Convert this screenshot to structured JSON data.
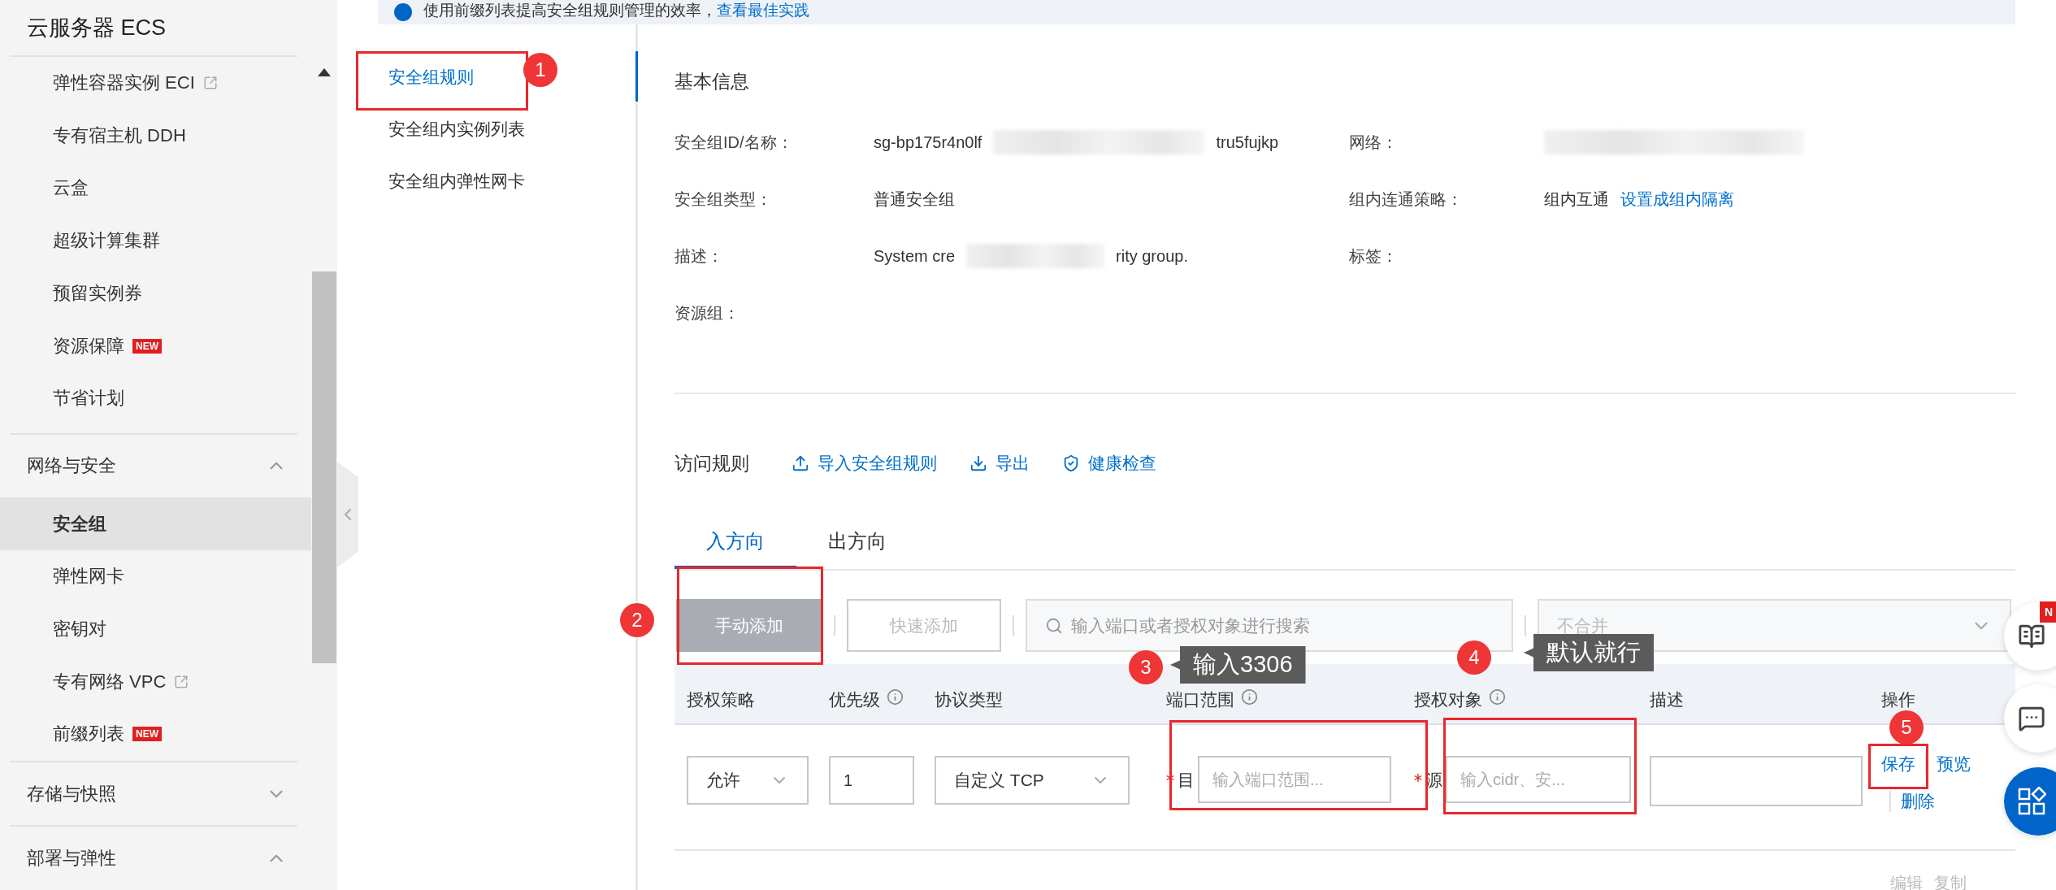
{
  "banner": {
    "text": "使用前缀列表提高安全组规则管理的效率，",
    "link": "查看最佳实践"
  },
  "sidebar": {
    "title": "云服务器 ECS",
    "items": [
      {
        "label": "弹性容器实例 ECI",
        "external": true,
        "selected": false
      },
      {
        "label": "专有宿主机 DDH",
        "external": false,
        "selected": false
      },
      {
        "label": "云盒",
        "external": false,
        "selected": false
      },
      {
        "label": "超级计算集群",
        "external": false,
        "selected": false
      },
      {
        "label": "预留实例券",
        "external": false,
        "selected": false
      },
      {
        "label": "资源保障",
        "external": false,
        "badge": "NEW",
        "selected": false
      },
      {
        "label": "节省计划",
        "external": false,
        "selected": false
      }
    ],
    "groups": [
      {
        "label": "网络与安全",
        "expanded": true,
        "children": [
          {
            "label": "安全组",
            "external": false,
            "selected": true
          },
          {
            "label": "弹性网卡",
            "external": false,
            "selected": false
          },
          {
            "label": "密钥对",
            "external": false,
            "selected": false
          },
          {
            "label": "专有网络 VPC",
            "external": true,
            "selected": false
          },
          {
            "label": "前缀列表",
            "external": false,
            "badge": "NEW",
            "selected": false
          }
        ]
      },
      {
        "label": "存储与快照",
        "expanded": false
      },
      {
        "label": "部署与弹性",
        "expanded": true
      }
    ]
  },
  "subnav": {
    "items": [
      {
        "label": "安全组规则",
        "selected": true
      },
      {
        "label": "安全组内实例列表",
        "selected": false
      },
      {
        "label": "安全组内弹性网卡",
        "selected": false
      }
    ]
  },
  "basic_info": {
    "title": "基本信息",
    "rows": [
      [
        {
          "label": "安全组ID/名称：",
          "value": "sg-bp175r4n0lf",
          "redacted": true,
          "value_tail": "tru5fujkp"
        },
        {
          "label": "网络：",
          "redacted": true
        }
      ],
      [
        {
          "label": "安全组类型：",
          "value": "普通安全组"
        },
        {
          "label": "组内连通策略：",
          "value": "组内互通",
          "link": "设置成组内隔离"
        }
      ],
      [
        {
          "label": "描述：",
          "value": "System cre",
          "redacted": true,
          "value_tail": "rity group."
        },
        {
          "label": "标签："
        }
      ],
      [
        {
          "label": "资源组："
        }
      ]
    ]
  },
  "access_rules": {
    "title": "访问规则",
    "actions": [
      {
        "label": "导入安全组规则",
        "kind": "upload"
      },
      {
        "label": "导出",
        "kind": "download"
      },
      {
        "label": "健康检查",
        "kind": "shield"
      }
    ],
    "tabs": [
      {
        "label": "入方向",
        "selected": true
      },
      {
        "label": "出方向",
        "selected": false
      }
    ],
    "toolbar": {
      "buttons": [
        {
          "label": "手动添加",
          "kind": "filled",
          "disabled": true
        },
        {
          "label": "快速添加",
          "kind": "outline",
          "disabled": true
        }
      ],
      "search": {
        "placeholder": "输入端口或者授权对象进行搜索"
      },
      "merge": {
        "value": "不合并",
        "disabled": true
      }
    },
    "table": {
      "columns": [
        {
          "label": "授权策略",
          "info": false
        },
        {
          "label": "优先级",
          "info": true
        },
        {
          "label": "协议类型",
          "info": false
        },
        {
          "label": "端口范围",
          "info": true
        },
        {
          "label": "授权对象",
          "info": true
        },
        {
          "label": "描述",
          "info": false
        },
        {
          "label": "操作",
          "info": false
        }
      ],
      "row": {
        "policy": "允许",
        "priority": "1",
        "protocol": "自定义 TCP",
        "port": {
          "prefix": "目",
          "required": true,
          "placeholder": "输入端口范围..."
        },
        "source": {
          "prefix": "源",
          "required": true,
          "placeholder": "输入cidr、安..."
        },
        "actions": [
          "保存",
          "预览",
          "删除"
        ]
      },
      "next_row_actions": [
        "编辑",
        "复制"
      ]
    }
  },
  "annotations": [
    {
      "number": "1"
    },
    {
      "number": "2"
    },
    {
      "number": "3"
    },
    {
      "number": "4"
    },
    {
      "number": "5"
    }
  ],
  "callouts": [
    {
      "text": "输入3306"
    },
    {
      "text": "默认就行"
    }
  ],
  "floating": {
    "badge": "N"
  }
}
